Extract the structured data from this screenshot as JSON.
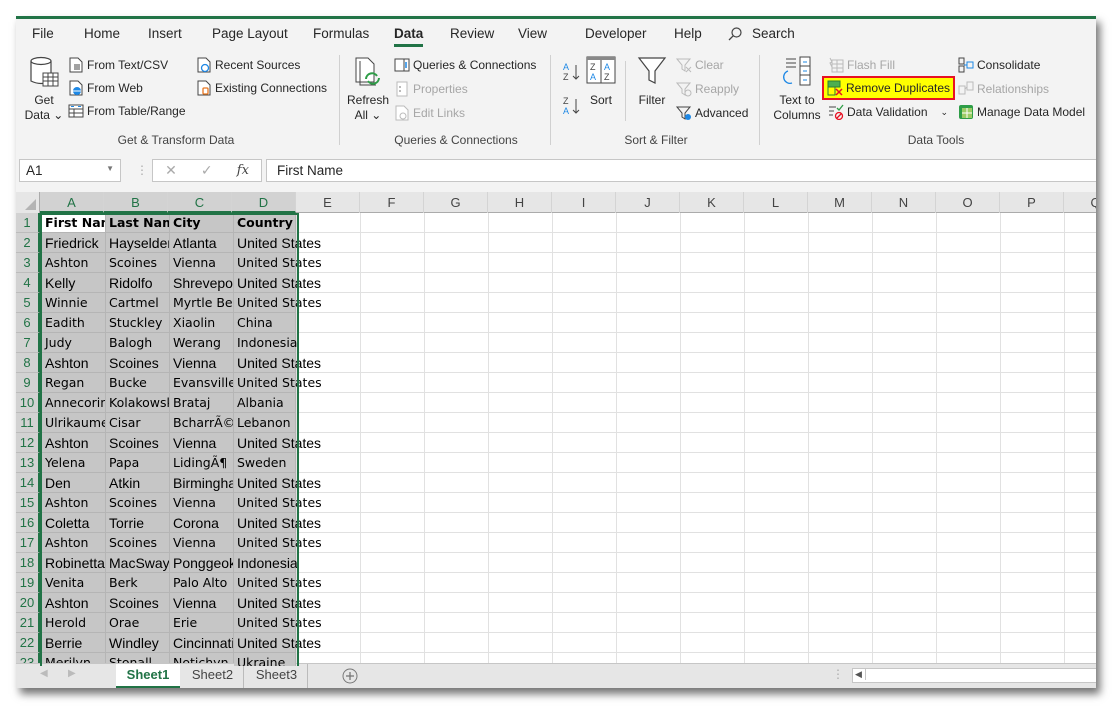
{
  "tabs": [
    {
      "label": "File",
      "active": false
    },
    {
      "label": "Home",
      "active": false
    },
    {
      "label": "Insert",
      "active": false
    },
    {
      "label": "Page Layout",
      "active": false
    },
    {
      "label": "Formulas",
      "active": false
    },
    {
      "label": "Data",
      "active": true
    },
    {
      "label": "Review",
      "active": false
    },
    {
      "label": "View",
      "active": false
    },
    {
      "label": "Developer",
      "active": false
    },
    {
      "label": "Help",
      "active": false
    }
  ],
  "search_label": "Search",
  "ribbon": {
    "get_transform": {
      "label": "Get & Transform Data",
      "get_data": "Get",
      "get_data2": "Data ⌄",
      "from_text_csv": "From Text/CSV",
      "from_web": "From Web",
      "from_table_range": "From Table/Range",
      "recent_sources": "Recent Sources",
      "existing_connections": "Existing Connections"
    },
    "queries": {
      "label": "Queries & Connections",
      "refresh_all": "Refresh",
      "refresh_all2": "All ⌄",
      "queries_connections": "Queries & Connections",
      "properties": "Properties",
      "edit_links": "Edit Links"
    },
    "sort_filter": {
      "label": "Sort & Filter",
      "sort": "Sort",
      "filter": "Filter",
      "clear": "Clear",
      "reapply": "Reapply",
      "advanced": "Advanced"
    },
    "data_tools": {
      "label": "Data Tools",
      "text_to_columns": "Text to",
      "text_to_columns2": "Columns",
      "flash_fill": "Flash Fill",
      "remove_duplicates": "Remove Duplicates",
      "data_validation": "Data Validation",
      "consolidate": "Consolidate",
      "relationships": "Relationships",
      "manage_data_model": "Manage Data Model"
    }
  },
  "formula_bar": {
    "name_box": "A1",
    "cancel": "✕",
    "enter": "✓",
    "fx": "fx",
    "value": "First Name"
  },
  "columns": [
    "A",
    "B",
    "C",
    "D",
    "E",
    "F",
    "G",
    "H",
    "I",
    "J",
    "K",
    "L",
    "M",
    "N",
    "O",
    "P",
    "Q"
  ],
  "rows": [
    [
      "First Name",
      "Last Name",
      "City",
      "Country"
    ],
    [
      "Friedrick",
      "Hayselder",
      "Atlanta",
      "United States"
    ],
    [
      "Ashton",
      "Scoines",
      "Vienna",
      "United States"
    ],
    [
      "Kelly",
      "Ridolfo",
      "Shreveport",
      "United States"
    ],
    [
      "Winnie",
      "Cartmel",
      "Myrtle Beach",
      "United States"
    ],
    [
      "Eadith",
      "Stuckley",
      "Xiaolin",
      "China"
    ],
    [
      "Judy",
      "Balogh",
      "Werang",
      "Indonesia"
    ],
    [
      "Ashton",
      "Scoines",
      "Vienna",
      "United States"
    ],
    [
      "Regan",
      "Bucke",
      "Evansville",
      "United States"
    ],
    [
      "Annecorinne",
      "Kolakowski",
      "Brataj",
      "Albania"
    ],
    [
      "Ulrikaumeko",
      "Cisar",
      "BcharrÃ©",
      "Lebanon"
    ],
    [
      "Ashton",
      "Scoines",
      "Vienna",
      "United States"
    ],
    [
      "Yelena",
      "Papa",
      "LidingÃ¶",
      "Sweden"
    ],
    [
      "Den",
      "Atkin",
      "Birmingham",
      "United States"
    ],
    [
      "Ashton",
      "Scoines",
      "Vienna",
      "United States"
    ],
    [
      "Coletta",
      "Torrie",
      "Corona",
      "United States"
    ],
    [
      "Ashton",
      "Scoines",
      "Vienna",
      "United States"
    ],
    [
      "Robinetta",
      "MacSwayde",
      "Ponggeok",
      "Indonesia"
    ],
    [
      "Venita",
      "Berk",
      "Palo Alto",
      "United States"
    ],
    [
      "Ashton",
      "Scoines",
      "Vienna",
      "United States"
    ],
    [
      "Herold",
      "Orae",
      "Erie",
      "United States"
    ],
    [
      "Berrie",
      "Windley",
      "Cincinnati",
      "United States"
    ],
    [
      "Merilyn",
      "Stonall",
      "Notichyn",
      "Ukraine"
    ]
  ],
  "sheets": [
    {
      "label": "Sheet1",
      "active": true
    },
    {
      "label": "Sheet2",
      "active": false
    },
    {
      "label": "Sheet3",
      "active": false
    }
  ]
}
